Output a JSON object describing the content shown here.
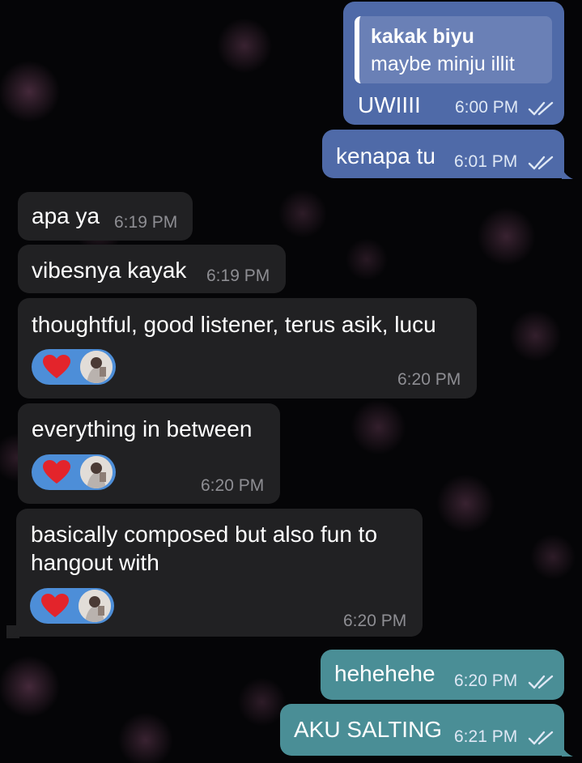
{
  "messages": [
    {
      "id": "m1",
      "direction": "outgoing",
      "reply": {
        "name": "kakak biyu",
        "text": "maybe minju illit"
      },
      "text": "UWIIII",
      "time": "6:00 PM",
      "status": "read"
    },
    {
      "id": "m2",
      "direction": "outgoing",
      "text": "kenapa tu",
      "time": "6:01 PM",
      "status": "read"
    },
    {
      "id": "m3",
      "direction": "incoming",
      "text": "apa ya",
      "time": "6:19 PM"
    },
    {
      "id": "m4",
      "direction": "incoming",
      "text": "vibesnya kayak",
      "time": "6:19 PM"
    },
    {
      "id": "m5",
      "direction": "incoming",
      "text": "thoughtful, good listener, terus asik, lucu",
      "time": "6:20 PM",
      "reaction": "heart-emoji"
    },
    {
      "id": "m6",
      "direction": "incoming",
      "text": "everything in between",
      "time": "6:20 PM",
      "reaction": "heart-emoji"
    },
    {
      "id": "m7",
      "direction": "incoming",
      "text_lines": [
        "basically composed but also fun to",
        "hangout with"
      ],
      "time": "6:20 PM",
      "reaction": "heart-emoji"
    },
    {
      "id": "m8",
      "direction": "outgoing",
      "text": "hehehehe",
      "time": "6:20 PM",
      "status": "read"
    },
    {
      "id": "m9",
      "direction": "outgoing",
      "text": "AKU SALTING",
      "time": "6:21 PM",
      "status": "read"
    }
  ],
  "colors": {
    "incoming_bubble": "#212123",
    "outgoing_blue": "#4F6AA8",
    "outgoing_teal": "#4A8E96",
    "reaction_pill": "#4d8ed8",
    "background": "#050507"
  },
  "icons": [
    "double-check-icon",
    "heart-emoji",
    "reactor-avatar"
  ]
}
